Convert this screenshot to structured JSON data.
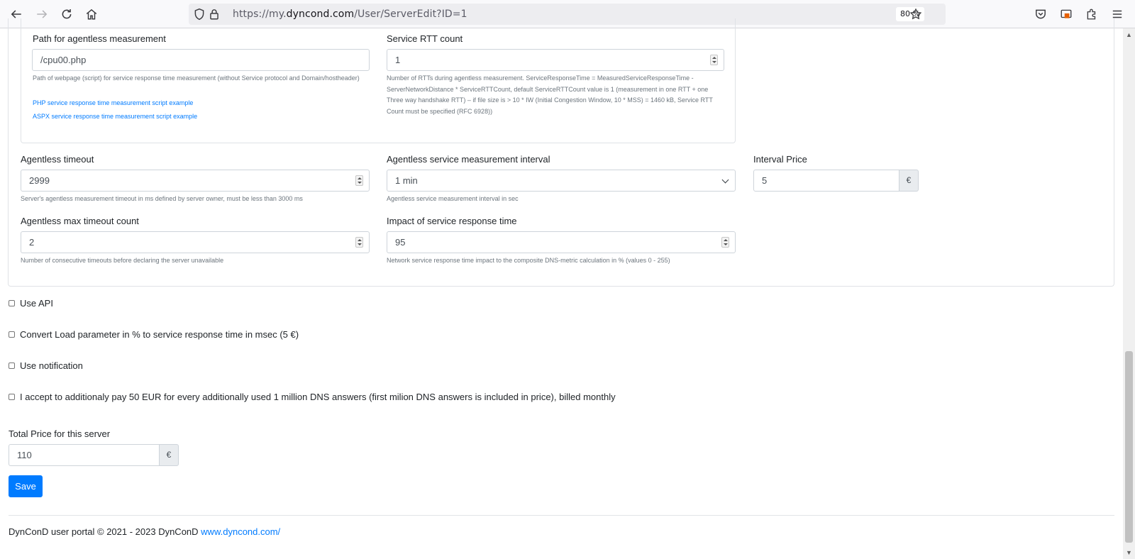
{
  "browser": {
    "url_prefix": "https://my.",
    "url_domain": "dyncond.com",
    "url_path": "/User/ServerEdit?ID=1",
    "zoom": "80 %"
  },
  "form": {
    "path_label": "Path for agentless measurement",
    "path_value": "/cpu00.php",
    "path_help": "Path of webpage (script) for service response time measurement (without Service protocol and Domain/hostheader)",
    "php_link": "PHP service response time measurement script example",
    "aspx_link": "ASPX service response time measurement script example",
    "rtt_label": "Service RTT count",
    "rtt_value": "1",
    "rtt_help": "Number of RTTs during agentless measurement. ServiceResponseTime = MeasuredServiceResponseTime - ServerNetworkDistance * ServiceRTTCount, default ServiceRTTCount value is 1 (measurement in one RTT + one Three way handshake RTT) – if file size is > 10 * IW (Initial Congestion Window, 10 * MSS) = 1460 kB, Service RTT Count must be specified (RFC 6928))",
    "timeout_label": "Agentless timeout",
    "timeout_value": "2999",
    "timeout_help": "Server's agentless measurement timeout in ms defined by server owner, must be less than 3000 ms",
    "interval_label": "Agentless service measurement interval",
    "interval_value": "1 min",
    "interval_help": "Agentless service measurement interval in sec",
    "price_label": "Interval Price",
    "price_value": "5",
    "currency": "€",
    "max_timeout_label": "Agentless max timeout count",
    "max_timeout_value": "2",
    "max_timeout_help": "Number of consecutive timeouts before declaring the server unavailable",
    "impact_label": "Impact of service response time",
    "impact_value": "95",
    "impact_help": "Network service response time impact to the composite DNS-metric calculation in % (values 0 - 255)"
  },
  "checkboxes": [
    {
      "label": "Use API",
      "checked": false
    },
    {
      "label": "Convert Load parameter in % to service response time in msec (5 €)",
      "checked": false
    },
    {
      "label": "Use notification",
      "checked": false
    },
    {
      "label": "I accept to additionaly pay 50 EUR for every additionally used 1 million DNS answers (first milion DNS answers is included in price), billed monthly",
      "checked": false
    }
  ],
  "total": {
    "label": "Total Price for this server",
    "value": "110",
    "currency": "€"
  },
  "save_label": "Save",
  "footer": {
    "text": "DynConD user portal © 2021 - 2023 DynConD ",
    "link": "www.dyncond.com/"
  }
}
